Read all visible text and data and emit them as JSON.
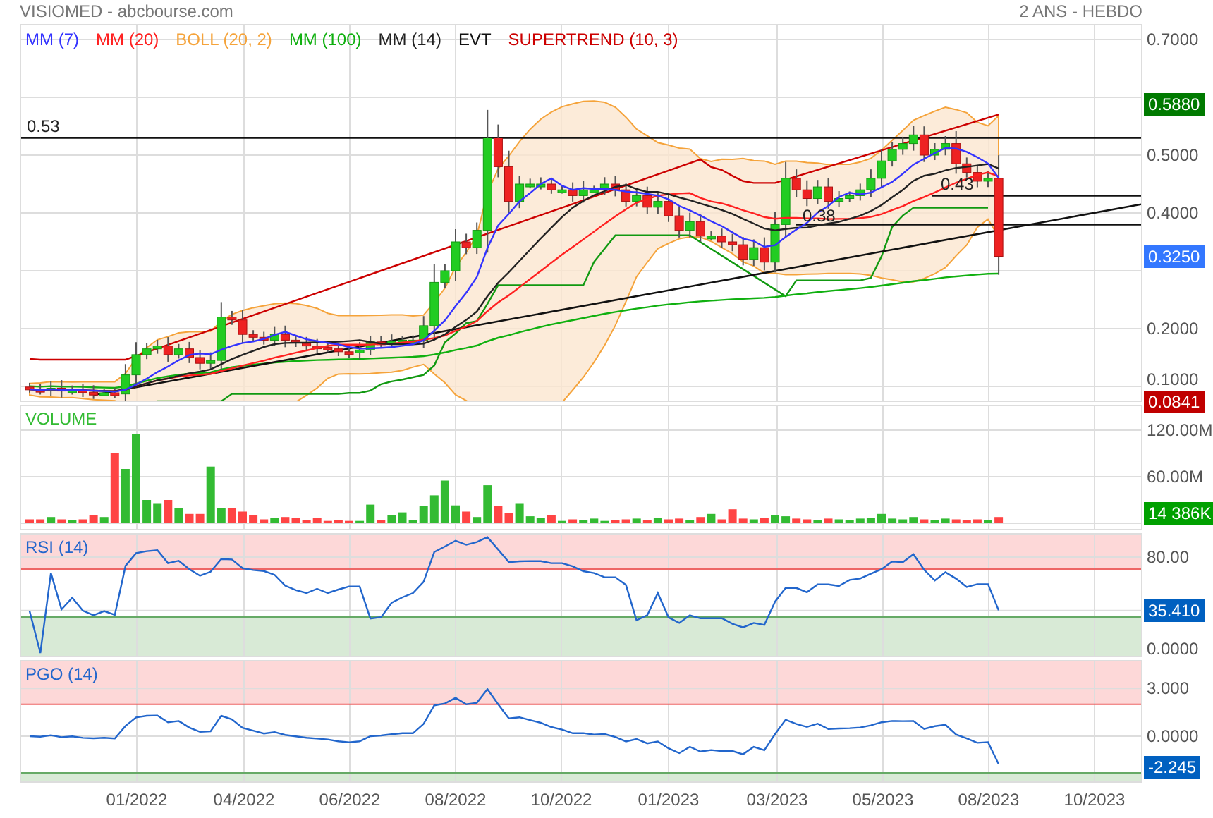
{
  "header": {
    "title": "VISIOMED - abcbourse.com",
    "period": "2 ANS - HEBDO"
  },
  "price_panel": {
    "legend": [
      {
        "label": "MM (7)",
        "color": "#3333ff"
      },
      {
        "label": "MM (20)",
        "color": "#ff2020"
      },
      {
        "label": "BOLL (20, 2)",
        "color": "#f5a33a"
      },
      {
        "label": "MM (100)",
        "color": "#10b010"
      },
      {
        "label": "MM (14)",
        "color": "#222222"
      },
      {
        "label": "EVT",
        "color": "#111111"
      },
      {
        "label": "SUPERTREND (10, 3)",
        "color": "#cc0000"
      }
    ],
    "levels": [
      {
        "label": "0.53"
      },
      {
        "label": "0.38"
      },
      {
        "label": "0.43"
      }
    ],
    "axis_labels": [
      "0.7000",
      "0.5000",
      "0.4000",
      "0.2000",
      "0.1000"
    ],
    "badges": [
      {
        "label": "0.5880",
        "color": "#007a00"
      },
      {
        "label": "0.3250",
        "color": "#3377ff"
      },
      {
        "label": "0.0841",
        "color": "#c00000"
      }
    ]
  },
  "volume_panel": {
    "title": "VOLUME",
    "axis_labels": [
      "120.00M",
      "60.00M"
    ],
    "badges": [
      {
        "label": "14 386K",
        "color": "#00a000"
      }
    ]
  },
  "rsi_panel": {
    "title": "RSI (14)",
    "axis_labels": [
      "80.00",
      "0.0000"
    ],
    "badges": [
      {
        "label": "35.410",
        "color": "#0060c0"
      }
    ]
  },
  "pgo_panel": {
    "title": "PGO (14)",
    "axis_labels": [
      "3.000",
      "0.0000"
    ],
    "badges": [
      {
        "label": "-2.245",
        "color": "#0060c0"
      }
    ]
  },
  "x_axis": {
    "labels": [
      "01/2022",
      "04/2022",
      "06/2022",
      "08/2022",
      "10/2022",
      "01/2023",
      "03/2023",
      "05/2023",
      "08/2023",
      "10/2023"
    ]
  }
}
